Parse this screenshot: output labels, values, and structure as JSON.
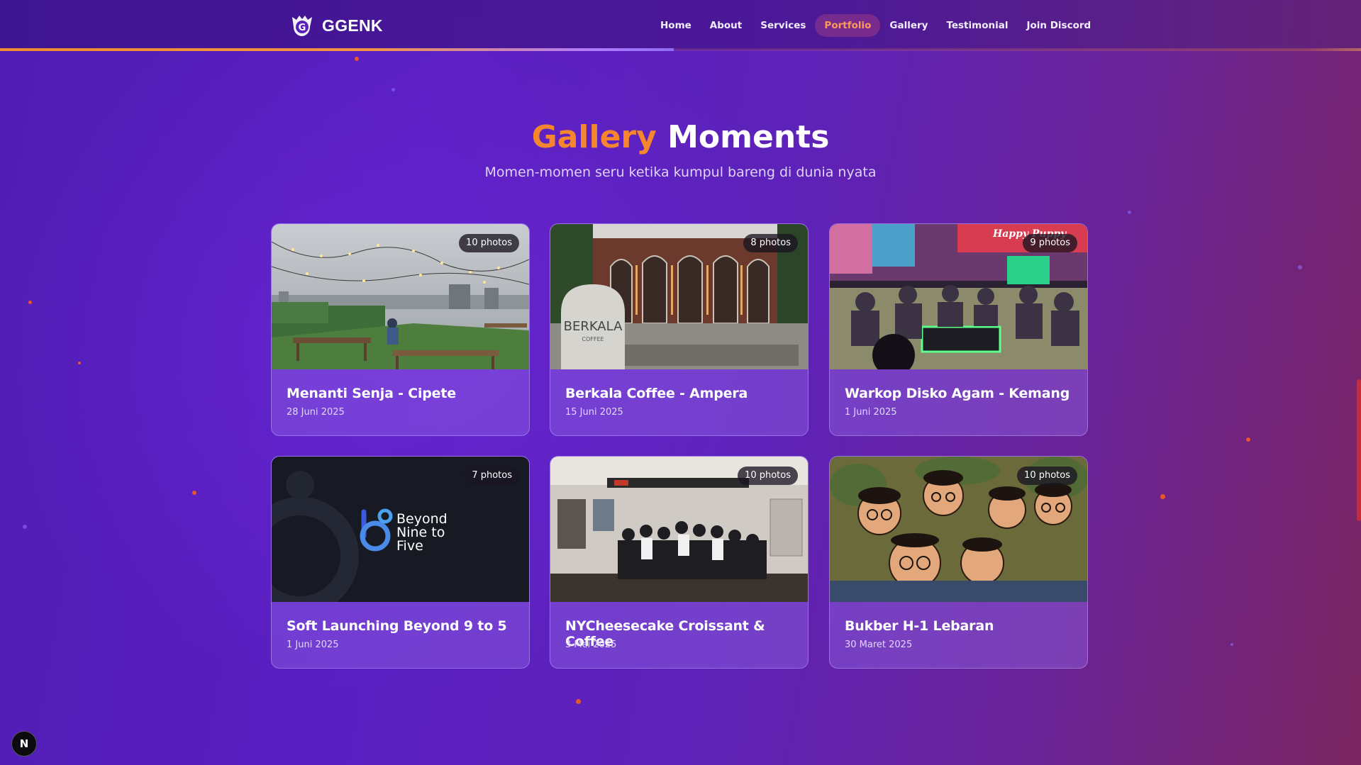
{
  "brand": {
    "name": "GGENK",
    "logo_icon": "ggenk-logo-icon"
  },
  "nav": {
    "items": [
      {
        "label": "Home",
        "active": false
      },
      {
        "label": "About",
        "active": false
      },
      {
        "label": "Services",
        "active": false
      },
      {
        "label": "Portfolio",
        "active": true
      },
      {
        "label": "Gallery",
        "active": false
      },
      {
        "label": "Testimonial",
        "active": false
      },
      {
        "label": "Join Discord",
        "active": false
      }
    ]
  },
  "scroll_progress": 0.495,
  "section": {
    "title_accent": "Gallery",
    "title_rest": "Moments",
    "subtitle": "Momen-momen seru ketika kumpul bareng di dunia nyata"
  },
  "cards": [
    {
      "title": "Menanti Senja - Cipete",
      "date": "28 Juni 2025",
      "photos": "10 photos"
    },
    {
      "title": "Berkala Coffee - Ampera",
      "date": "15 Juni 2025",
      "photos": "8 photos"
    },
    {
      "title": "Warkop Disko Agam - Kemang",
      "date": "1 Juni 2025",
      "photos": "9 photos"
    },
    {
      "title": "Soft Launching Beyond 9 to 5",
      "date": "1 Juni 2025",
      "photos": "7 photos"
    },
    {
      "title": "NYCheesecake Croissant & Coffee",
      "date": "3 Mei 2025",
      "photos": "10 photos"
    },
    {
      "title": "Bukber H-1 Lebaran",
      "date": "30 Maret 2025",
      "photos": "10 photos"
    }
  ],
  "images": {
    "berkala_sign": "BERKALA",
    "berkala_sub": "COFFEE",
    "happy_puppy": "Happy Puppy",
    "beyond_line1": "Beyond",
    "beyond_line2": "Nine to",
    "beyond_line3": "Five"
  },
  "next_badge": "N",
  "colors": {
    "accent": "#f5862e",
    "active_nav": "#ff9a55"
  }
}
